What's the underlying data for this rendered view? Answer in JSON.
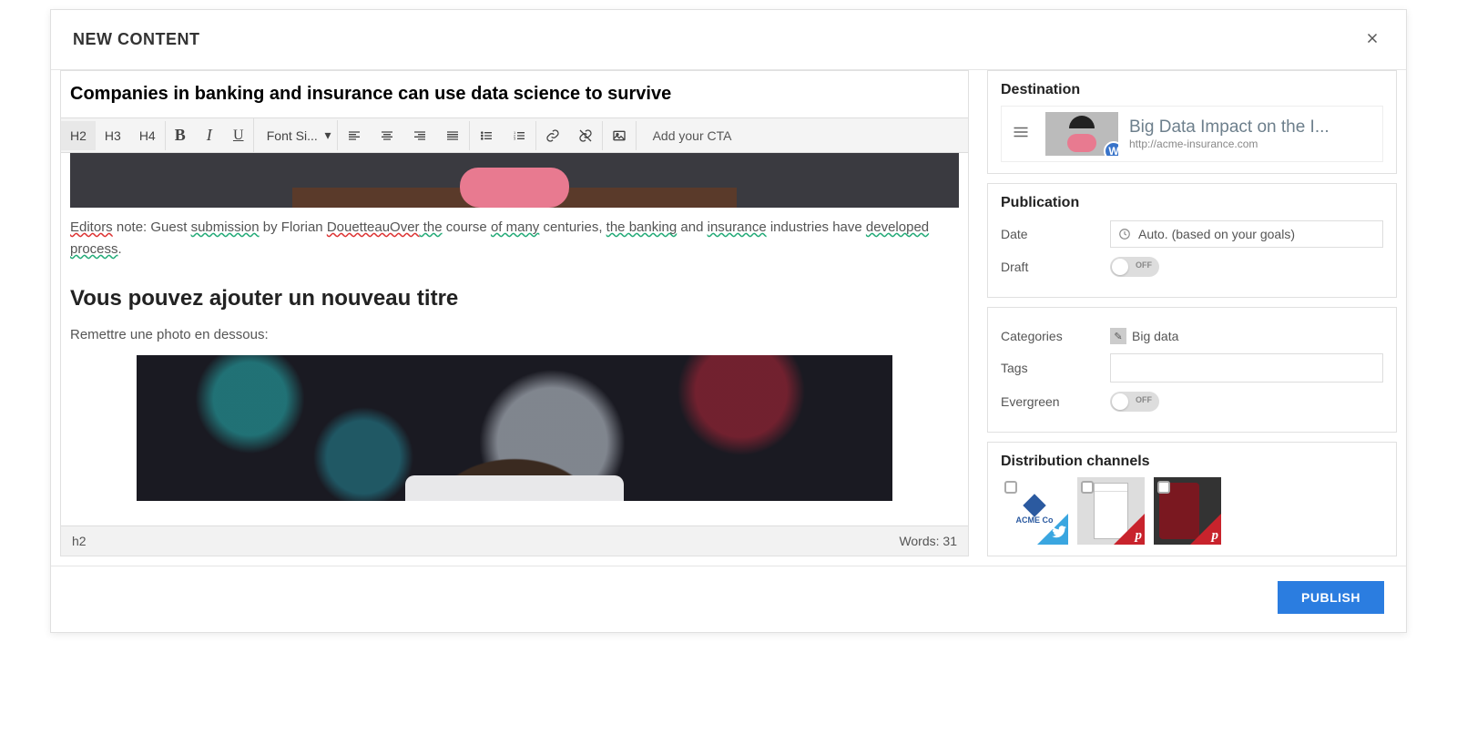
{
  "modal": {
    "title": "NEW CONTENT"
  },
  "editor": {
    "title_value": "Companies in banking and insurance can use data science to survive",
    "toolbar": {
      "h2": "H2",
      "h3": "H3",
      "h4": "H4",
      "bold": "B",
      "italic": "I",
      "underline": "U",
      "font_size": "Font Si...",
      "cta": "Add your CTA"
    },
    "body": {
      "intro_pre": "Editors",
      "intro_mid1": " note: Guest ",
      "intro_mid2": "submission",
      "intro_mid3": " by Florian ",
      "intro_mid4": "DouetteauOver",
      "intro_mid4a": " the",
      "intro_mid5": " course ",
      "intro_mid6": "of many",
      "intro_mid7": " centuries, ",
      "intro_mid8": "the banking",
      "intro_mid8a": " and ",
      "intro_mid8b": "insurance",
      "intro_mid9": " industries have ",
      "intro_mid10": "developed",
      "intro_mid10a": " process",
      "intro_end": ".",
      "heading": "Vous pouvez ajouter un nouveau titre",
      "caption": "Remettre une photo en dessous:"
    },
    "footer": {
      "path": "h2",
      "words_label": "Words: ",
      "words_count": "31"
    }
  },
  "sidebar": {
    "destination": {
      "title": "Destination",
      "item_title": "Big Data Impact on the I...",
      "item_url": "http://acme-insurance.com",
      "wp_badge": "W"
    },
    "publication": {
      "title": "Publication",
      "date_label": "Date",
      "date_value": "Auto. (based on your goals)",
      "draft_label": "Draft",
      "draft_state": "OFF"
    },
    "meta": {
      "categories_label": "Categories",
      "categories_value": "Big data",
      "tags_label": "Tags",
      "tags_value": "",
      "evergreen_label": "Evergreen",
      "evergreen_state": "OFF"
    },
    "distribution": {
      "title": "Distribution channels",
      "ch1_label": "ACME Co",
      "pin_symbol": "p",
      "tw_symbol": "🐦"
    }
  },
  "footer": {
    "publish": "PUBLISH"
  }
}
